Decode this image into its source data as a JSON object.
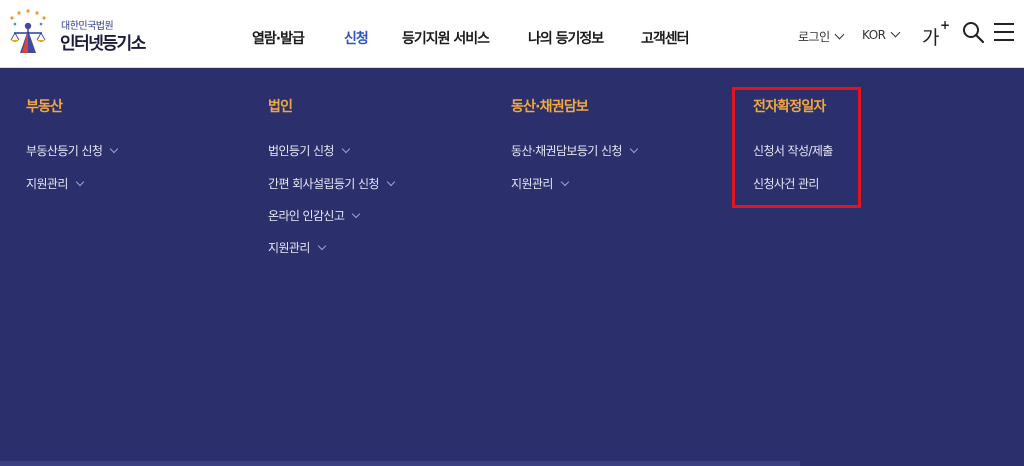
{
  "header": {
    "logo_sub": "대한민국법원",
    "logo_main": "인터넷등기소",
    "nav": [
      {
        "label": "열람·발급",
        "active": false
      },
      {
        "label": "신청",
        "active": true
      },
      {
        "label": "등기지원 서비스",
        "active": false
      },
      {
        "label": "나의 등기정보",
        "active": false
      },
      {
        "label": "고객센터",
        "active": false
      }
    ],
    "login_label": "로그인",
    "language_label": "KOR",
    "font_size_label": "가",
    "font_size_plus": "+"
  },
  "menu": {
    "columns": [
      {
        "title": "부동산",
        "items": [
          "부동산등기 신청",
          "지원관리"
        ]
      },
      {
        "title": "법인",
        "items": [
          "법인등기 신청",
          "간편 회사설립등기 신청",
          "온라인 인감신고",
          "지원관리"
        ]
      },
      {
        "title": "동산·채권담보",
        "items": [
          "동산·채권담보등기 신청",
          "지원관리"
        ]
      },
      {
        "title": "전자확정일자",
        "items": [
          "신청서 작성/제출",
          "신청사건 관리"
        ]
      }
    ]
  },
  "colors": {
    "panel_bg": "#2b2f6b",
    "column_title": "#f2a93b",
    "active_nav": "#2b55c9",
    "highlight_border": "#e3141c"
  }
}
